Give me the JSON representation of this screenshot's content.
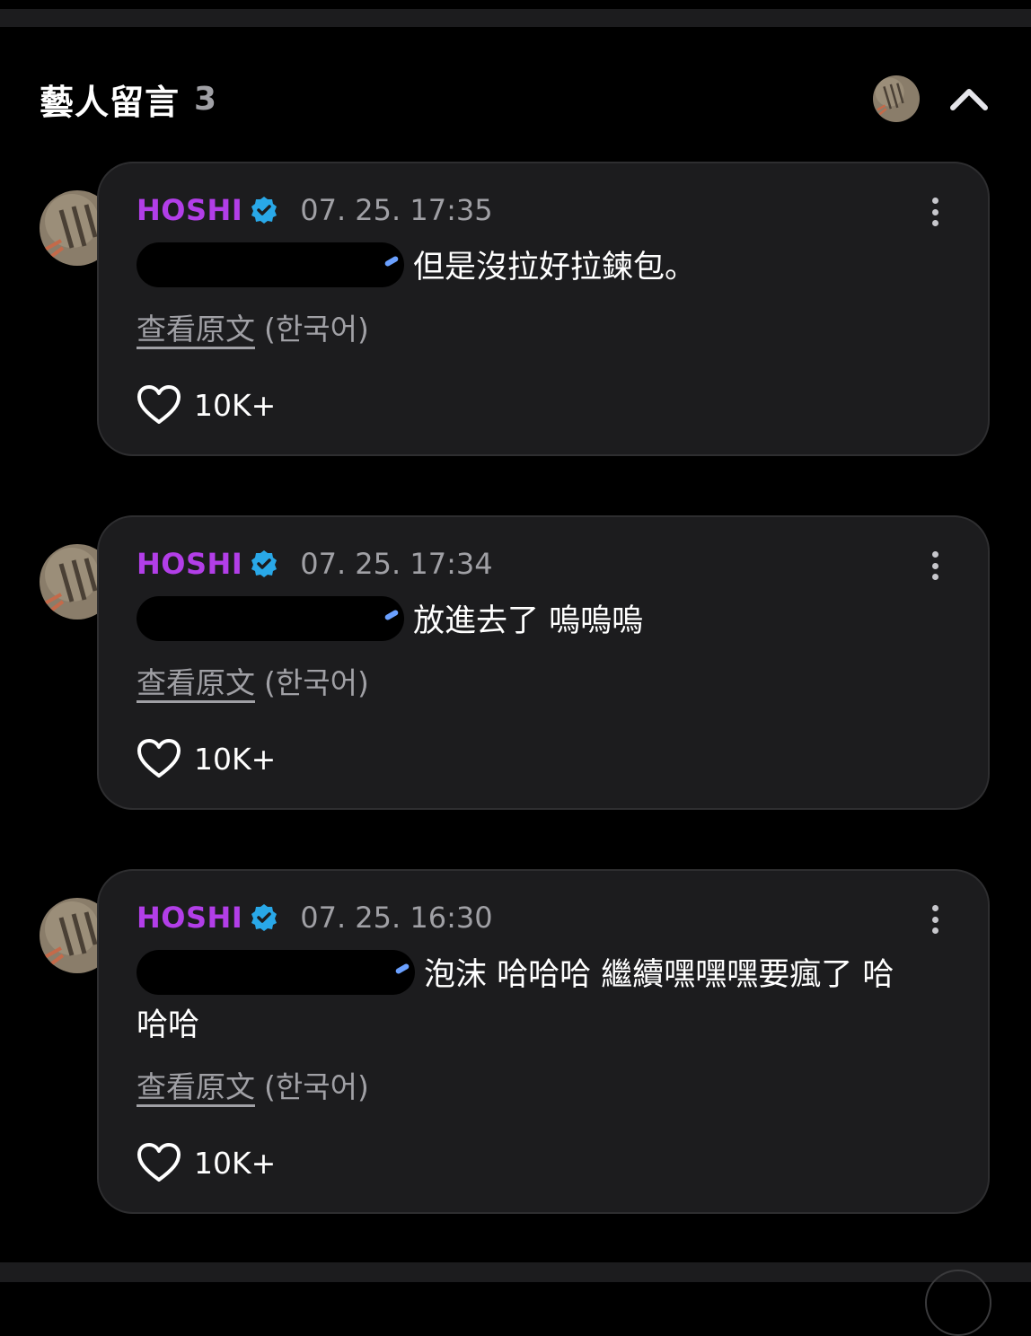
{
  "header": {
    "title": "藝人留言",
    "count": "3"
  },
  "colors": {
    "author": "#b23ee8",
    "verified": "#29a8e8",
    "meta": "#a0a0a5",
    "card_bg": "#1c1c1e"
  },
  "comments": [
    {
      "author": "HOSHI",
      "time": "07. 25. 17:35",
      "text": "但是沒拉好拉鍊包。",
      "view_original": "查看原文",
      "language": "(한국어)",
      "likes": "10K+"
    },
    {
      "author": "HOSHI",
      "time": "07. 25. 17:34",
      "text": "放進去了 嗚嗚嗚",
      "view_original": "查看原文",
      "language": "(한국어)",
      "likes": "10K+"
    },
    {
      "author": "HOSHI",
      "time": "07. 25. 16:30",
      "text": "泡沫 哈哈哈 繼續嘿嘿嘿要瘋了 哈哈哈",
      "view_original": "查看原文",
      "language": "(한국어)",
      "likes": "10K+"
    }
  ]
}
